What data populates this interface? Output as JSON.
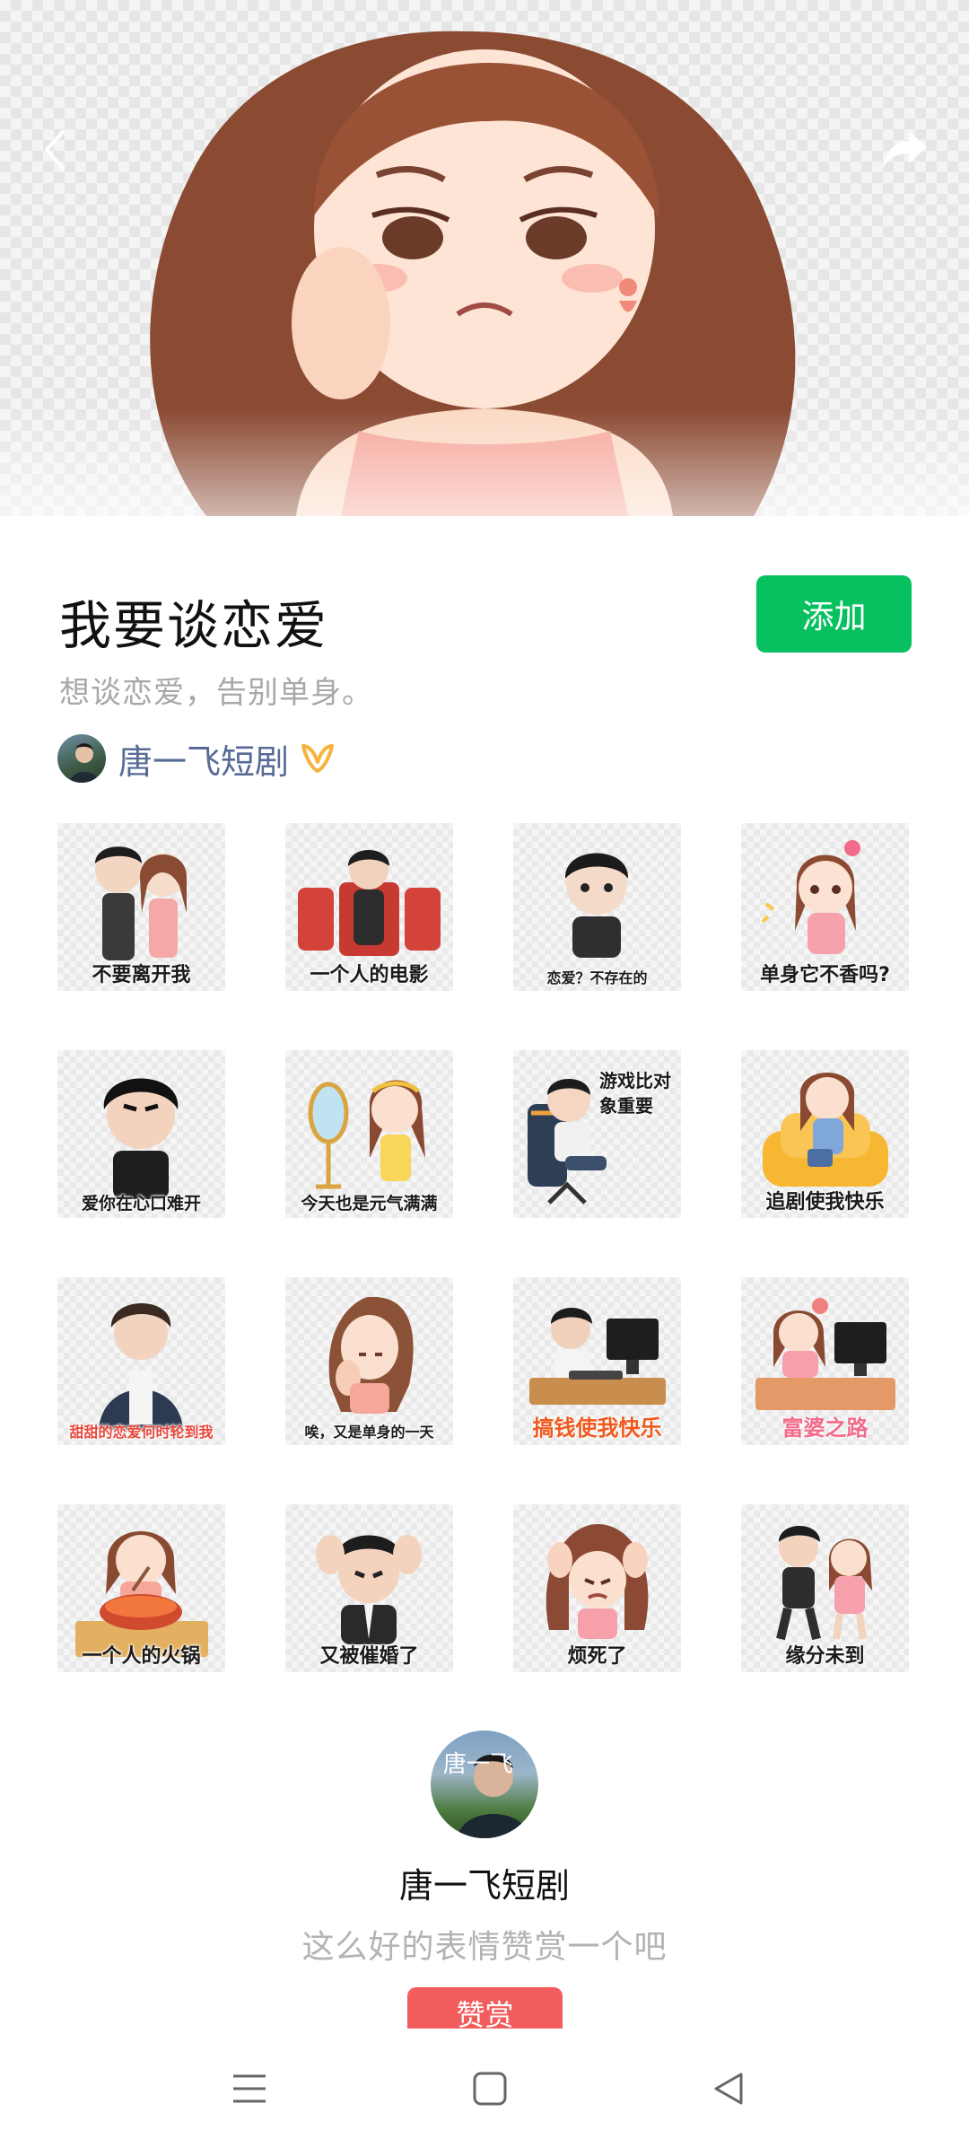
{
  "pack": {
    "title": "我要谈恋爱",
    "subtitle": "想谈恋爱，告别单身。",
    "add_label": "添加"
  },
  "author": {
    "name": "唐一飞短剧",
    "avatar_text": "唐一飞"
  },
  "stickers": [
    {
      "caption": "不要离开我"
    },
    {
      "caption": "一个人的电影"
    },
    {
      "caption": "恋爱？不存在的"
    },
    {
      "caption": "单身它不香吗?"
    },
    {
      "caption": "爱你在心口难开"
    },
    {
      "caption": "今天也是元气满满"
    },
    {
      "caption": "游戏比对象重要"
    },
    {
      "caption": "追剧使我快乐"
    },
    {
      "caption": "甜甜的恋爱何时轮到我"
    },
    {
      "caption": "唉，又是单身的一天"
    },
    {
      "caption": "搞钱使我快乐"
    },
    {
      "caption": "富婆之路"
    },
    {
      "caption": "一个人的火锅"
    },
    {
      "caption": "又被催婚了"
    },
    {
      "caption": "烦死了"
    },
    {
      "caption": "缘分未到"
    }
  ],
  "reward": {
    "name": "唐一飞短剧",
    "tip": "这么好的表情赞赏一个吧",
    "button_label": "赞赏"
  },
  "icons": {
    "back": "chevron-left-icon",
    "share": "share-arrow-icon",
    "verify": "creator-badge-icon",
    "nav_menu": "menu-lines-icon",
    "nav_home": "square-home-icon",
    "nav_back": "triangle-back-icon"
  },
  "colors": {
    "accent_green": "#07c160",
    "author_link": "#576b95",
    "reward_red": "#f25c5c",
    "verify_orange": "#f7b23b"
  }
}
